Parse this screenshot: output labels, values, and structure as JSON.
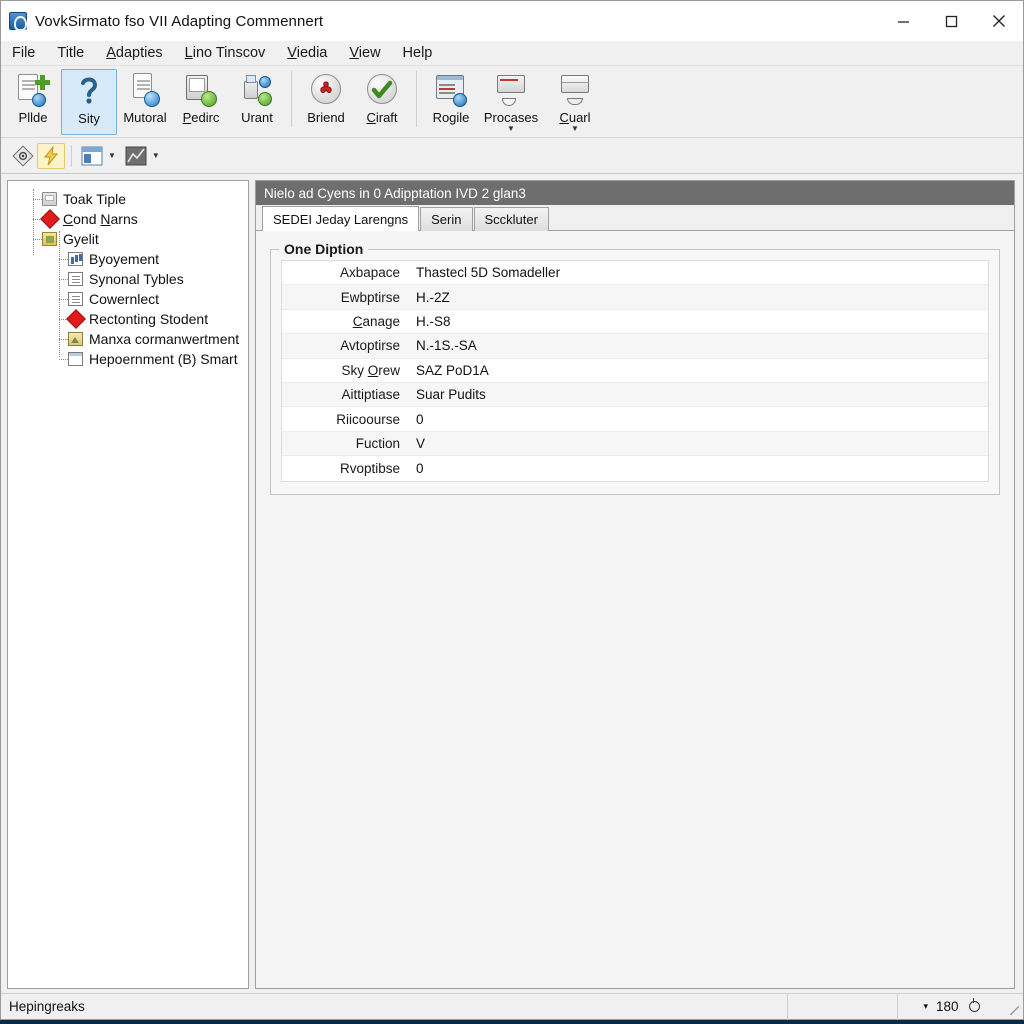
{
  "window": {
    "title": "VovkSirmato fso VII Adapting Commennert",
    "icon": "app-icon",
    "controls": {
      "minimize": "minimize-icon",
      "maximize": "maximize-icon",
      "close": "close-icon"
    }
  },
  "menubar": {
    "items": [
      {
        "label": "File",
        "mnemonic": ""
      },
      {
        "label": "Title",
        "mnemonic": ""
      },
      {
        "label": "Adapties",
        "mnemonic": "A"
      },
      {
        "label": "Lino Tinscov",
        "mnemonic": "L"
      },
      {
        "label": "Viedia",
        "mnemonic": "V"
      },
      {
        "label": "View",
        "mnemonic": "V"
      },
      {
        "label": "Help",
        "mnemonic": ""
      }
    ]
  },
  "toolbar": {
    "buttons": [
      {
        "label": "Pllde",
        "icon": "clipboard-add-icon",
        "selected": false,
        "dropdown": false,
        "mnemonic": ""
      },
      {
        "label": "Sity",
        "icon": "question-mark-icon",
        "selected": true,
        "dropdown": false,
        "mnemonic": ""
      },
      {
        "label": "Mutoral",
        "icon": "document-refresh-icon",
        "selected": false,
        "dropdown": false,
        "mnemonic": ""
      },
      {
        "label": "Pedirc",
        "icon": "book-green-icon",
        "selected": false,
        "dropdown": false,
        "mnemonic": "P"
      },
      {
        "label": "Urant",
        "icon": "jar-tools-icon",
        "selected": false,
        "dropdown": false,
        "mnemonic": ""
      },
      {
        "label": "Briend",
        "icon": "red-cross-circle-icon",
        "selected": false,
        "dropdown": false,
        "mnemonic": ""
      },
      {
        "label": "Ciraft",
        "icon": "green-check-circle-icon",
        "selected": false,
        "dropdown": false,
        "mnemonic": "C"
      },
      {
        "label": "Rogile",
        "icon": "report-window-icon",
        "selected": false,
        "dropdown": false,
        "mnemonic": ""
      },
      {
        "label": "Procases",
        "icon": "window-cup-icon",
        "selected": false,
        "dropdown": true,
        "mnemonic": ""
      },
      {
        "label": "Cuarl",
        "icon": "window-saucer-icon",
        "selected": false,
        "dropdown": true,
        "mnemonic": "C"
      }
    ],
    "separator_after": [
      4,
      6
    ]
  },
  "toolbar2": {
    "buttons": [
      {
        "icon": "eye-diamond-icon",
        "highlighted": false,
        "dropdown": false
      },
      {
        "icon": "lightning-yellow-icon",
        "highlighted": true,
        "dropdown": false
      },
      {
        "icon": "blue-window-icon",
        "highlighted": false,
        "dropdown": true
      },
      {
        "icon": "dark-chart-icon",
        "highlighted": false,
        "dropdown": true
      }
    ]
  },
  "tree": {
    "nodes": [
      {
        "label": "Toak Tiple",
        "icon": "folder-icon",
        "level": 1,
        "underline": ""
      },
      {
        "label": "Cond Narns",
        "icon": "red-diamond-icon",
        "level": 1,
        "underline": "C"
      },
      {
        "label": "Gyelit",
        "icon": "gold-folder-icon",
        "level": 1,
        "underline": ""
      },
      {
        "label": "Byoyement",
        "icon": "chart-icon",
        "level": 2,
        "underline": ""
      },
      {
        "label": "Synonal Tybles",
        "icon": "document-icon",
        "level": 2,
        "underline": ""
      },
      {
        "label": "Cowernlect",
        "icon": "document-icon",
        "level": 2,
        "underline": ""
      },
      {
        "label": "Rectonting Stodent",
        "icon": "red-diamond-icon",
        "level": 2,
        "underline": ""
      },
      {
        "label": "Manxa cormanwertment",
        "icon": "image-icon",
        "level": 2,
        "underline": ""
      },
      {
        "label": "Hepoernment (B) Smart",
        "icon": "window-icon",
        "level": 2,
        "underline": ""
      }
    ]
  },
  "panel": {
    "header": "Nielo ad Cyens in 0 Adipptation IVD 2 glan3",
    "tabs": [
      {
        "label": "SEDEI Jeday Larengns",
        "active": true
      },
      {
        "label": "Serin",
        "active": false
      },
      {
        "label": "Scckluter",
        "active": false
      }
    ],
    "group_title": "One Diption",
    "properties": [
      {
        "key": "Axbapace",
        "value": "Thastecl 5D Somadeller"
      },
      {
        "key": "Ewbptirse",
        "value": "H.-2Z"
      },
      {
        "key": "Canage",
        "value": "H.-S8"
      },
      {
        "key": "Avtoptirse",
        "value": "N.-1S.-SA"
      },
      {
        "key": "Sky Orew",
        "value": "SAZ PoD1A"
      },
      {
        "key": "Aittiptiase",
        "value": "Suar Pudits"
      },
      {
        "key": "Riicoourse",
        "value": "0"
      },
      {
        "key": "Fuction",
        "value": "V"
      },
      {
        "key": "Rvoptibse",
        "value": "0"
      }
    ]
  },
  "statusbar": {
    "message": "Hepingreaks",
    "cell_blank": "",
    "zoom_caret": "▾",
    "zoom_value": "180"
  },
  "colors": {
    "accent": "#1a6fbb",
    "header_bar": "#6e6e6e",
    "selection": "#d6eaf9",
    "highlight": "#fdf3c8",
    "red": "#e01b1b",
    "green": "#4f9c28"
  }
}
